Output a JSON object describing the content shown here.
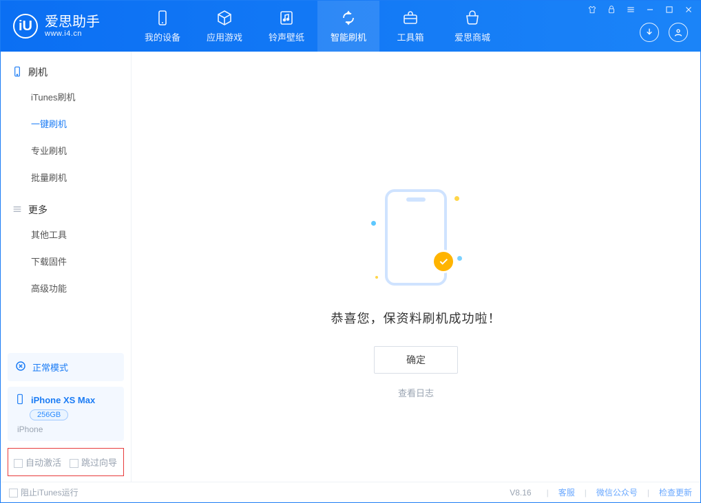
{
  "logo": {
    "name": "爱思助手",
    "sub": "www.i4.cn",
    "mark": "iU"
  },
  "nav": {
    "tabs": [
      {
        "label": "我的设备",
        "icon": "device-icon"
      },
      {
        "label": "应用游戏",
        "icon": "cube-icon"
      },
      {
        "label": "铃声壁纸",
        "icon": "music-icon"
      },
      {
        "label": "智能刷机",
        "icon": "refresh-icon",
        "active": true
      },
      {
        "label": "工具箱",
        "icon": "toolbox-icon"
      },
      {
        "label": "爱思商城",
        "icon": "cart-icon"
      }
    ]
  },
  "sidebar": {
    "section_flash": "刷机",
    "section_more": "更多",
    "flash_items": [
      {
        "label": "iTunes刷机"
      },
      {
        "label": "一键刷机",
        "active": true
      },
      {
        "label": "专业刷机"
      },
      {
        "label": "批量刷机"
      }
    ],
    "more_items": [
      {
        "label": "其他工具"
      },
      {
        "label": "下载固件"
      },
      {
        "label": "高级功能"
      }
    ],
    "mode": "正常模式",
    "device": {
      "name": "iPhone XS Max",
      "capacity": "256GB",
      "type": "iPhone"
    },
    "opts": {
      "auto_activate": "自动激活",
      "skip_guide": "跳过向导"
    }
  },
  "main": {
    "success": "恭喜您，保资料刷机成功啦！",
    "ok": "确定",
    "view_log": "查看日志"
  },
  "footer": {
    "block_itunes": "阻止iTunes运行",
    "version": "V8.16",
    "service": "客服",
    "wechat": "微信公众号",
    "update": "检查更新"
  }
}
